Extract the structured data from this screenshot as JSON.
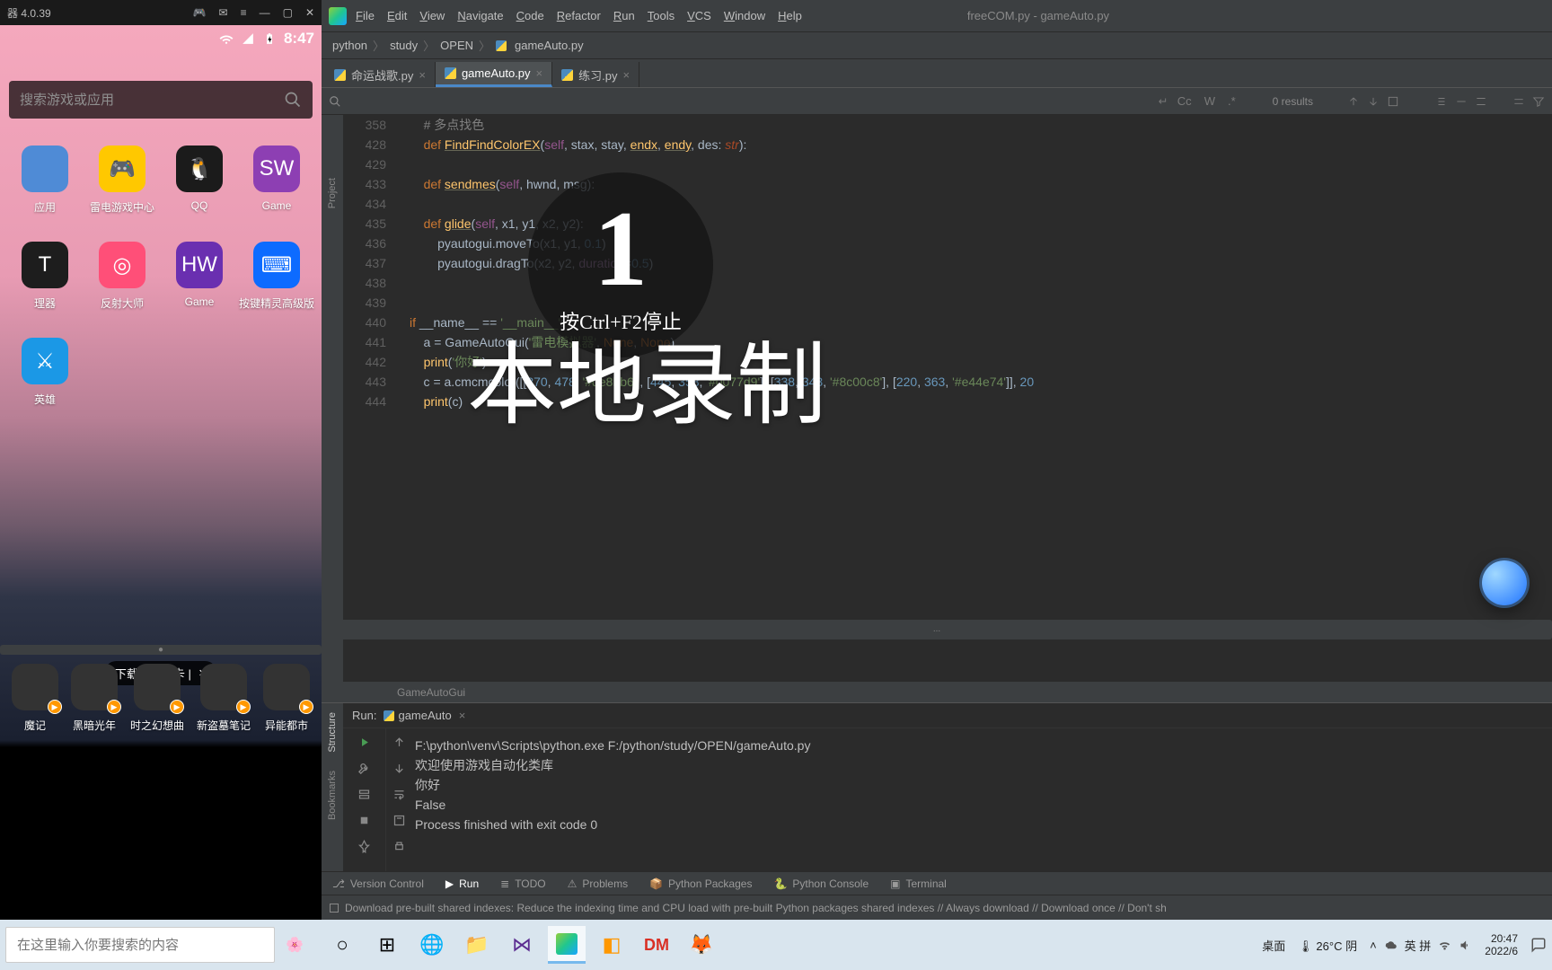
{
  "emulator": {
    "title": "器 4.0.39",
    "clock": "8:47",
    "search_placeholder": "搜索游戏或应用",
    "apps_row1": [
      {
        "label": "应用",
        "bg": "#4f8bd6"
      },
      {
        "label": "雷电游戏中心",
        "bg": "#ffc800",
        "glyph": "🎮"
      },
      {
        "label": "QQ",
        "bg": "#1b1b1b",
        "glyph": "🐧"
      },
      {
        "label": "Game",
        "bg": "#8d3fb3",
        "glyph": "SW"
      }
    ],
    "apps_row2": [
      {
        "label": "理器",
        "bg": "#1d1d1d",
        "glyph": "T"
      },
      {
        "label": "反射大师",
        "bg": "#ff4f78",
        "glyph": "◎"
      },
      {
        "label": "Game",
        "bg": "#6a2fb0",
        "glyph": "HW"
      },
      {
        "label": "按键精灵高级版",
        "bg": "#0d6bff",
        "glyph": "⌨"
      }
    ],
    "apps_row3": [
      {
        "label": "英雄",
        "bg": "#1b98e6",
        "glyph": "⚔"
      }
    ],
    "promo": "下载送京东卡  |",
    "dock": [
      {
        "label": "魔记"
      },
      {
        "label": "黑暗光年"
      },
      {
        "label": "时之幻想曲"
      },
      {
        "label": "新盗墓笔记"
      },
      {
        "label": "异能都市"
      }
    ]
  },
  "ide": {
    "menu": [
      "File",
      "Edit",
      "View",
      "Navigate",
      "Code",
      "Refactor",
      "Run",
      "Tools",
      "VCS",
      "Window",
      "Help"
    ],
    "title_center": "freeCOM.py - gameAuto.py",
    "breadcrumb": [
      "python",
      "study",
      "OPEN",
      "gameAuto.py"
    ],
    "tabs": [
      {
        "label": "命运战歌.py",
        "active": false
      },
      {
        "label": "gameAuto.py",
        "active": true
      },
      {
        "label": "练习.py",
        "active": false
      }
    ],
    "findbar": {
      "results": "0 results",
      "opts": [
        "Cc",
        "W",
        ".*"
      ]
    },
    "crumb_footer": "GameAutoGui",
    "gutter_labels": {
      "project": "Project",
      "structure": "Structure",
      "bookmarks": "Bookmarks"
    },
    "lines": [
      {
        "n": 358,
        "html": "    <span class='kw'>def</span> <span class='fnu'>FindFindColorEX</span>(<span class='slf'>self</span>, stax, stay, <span class='fnu'>endx</span>, <span class='fnu'>endy</span>, des: <span class='prm'>str</span>):<span class='dots'>...</span>"
      },
      {
        "n": 428,
        "html": ""
      },
      {
        "n": 429,
        "html": "    <span class='kw'>def</span> <span class='fnu'>sendmes</span>(<span class='slf'>self</span>, hwnd, msg):<span class='dots'>...</span>"
      },
      {
        "n": 433,
        "html": ""
      },
      {
        "n": 434,
        "html": "    <span class='kw'>def</span> <span class='fnu'>glide</span>(<span class='slf'>self</span>, x1, y1, x2, y2):"
      },
      {
        "n": 435,
        "html": "        pyautogui.moveTo(x1, y1, <span class='num'>0.1</span>)"
      },
      {
        "n": 436,
        "html": "        pyautogui.dragTo(x2, y2, <span class='attr'>duration</span>=<span class='num'>0.5</span>)"
      },
      {
        "n": 437,
        "html": ""
      },
      {
        "n": 438,
        "html": ""
      },
      {
        "n": 439,
        "html": "<span class='kw'>if</span> __name__ == <span class='str'>'__main__'</span>:",
        "run": true
      },
      {
        "n": 440,
        "html": "    a = GameAutoGui(<span class='str'>'雷电模拟器'</span>, <span class='kw'>None</span>, <span class='kw'>None</span>)"
      },
      {
        "n": 441,
        "html": "    <span class='fn'>print</span>(<span class='str'>'你好'</span>)"
      },
      {
        "n": 442,
        "html": "    c = a.cmcmcolor([[<span class='num'>370</span>, <span class='num'>478</span>, <span class='str'>'#de8bb6'</span>], [<span class='num'>445</span>, <span class='num'>358</span>, <span class='str'>'#0077d9'</span>], [<span class='num'>338</span>, <span class='num'>343</span>, <span class='str'>'#8c00c8'</span>], [<span class='num'>220</span>, <span class='num'>363</span>, <span class='str'>'#e44e74'</span>]], <span class='num'>20</span>"
      },
      {
        "n": 443,
        "html": "    <span class='fn'>print</span>(c)"
      },
      {
        "n": 444,
        "html": ""
      }
    ],
    "run": {
      "label": "Run:",
      "tab_name": "gameAuto",
      "console": [
        "F:\\python\\venv\\Scripts\\python.exe F:/python/study/OPEN/gameAuto.py",
        "欢迎使用游戏自动化类库",
        "你好",
        "False",
        "",
        "Process finished with exit code 0"
      ]
    },
    "bottom_tabs": [
      {
        "label": "Version Control",
        "icon": "branch"
      },
      {
        "label": "Run",
        "icon": "play",
        "active": true
      },
      {
        "label": "TODO",
        "icon": "list"
      },
      {
        "label": "Problems",
        "icon": "warn"
      },
      {
        "label": "Python Packages",
        "icon": "pkg"
      },
      {
        "label": "Python Console",
        "icon": "py"
      },
      {
        "label": "Terminal",
        "icon": "term"
      }
    ],
    "status_msg": "Download pre-built shared indexes: Reduce the indexing time and CPU load with pre-built Python packages shared indexes // Always download // Download once // Don't sh"
  },
  "overlay": {
    "big": "1",
    "sub": "按Ctrl+F2停止",
    "main": "本地录制"
  },
  "taskbar": {
    "search_placeholder": "在这里输入你要搜索的内容",
    "weather": "26°C 阴",
    "desktop": "桌面",
    "ime": "英  拼",
    "clock": {
      "time": "20:47",
      "date": "2022/6"
    }
  }
}
